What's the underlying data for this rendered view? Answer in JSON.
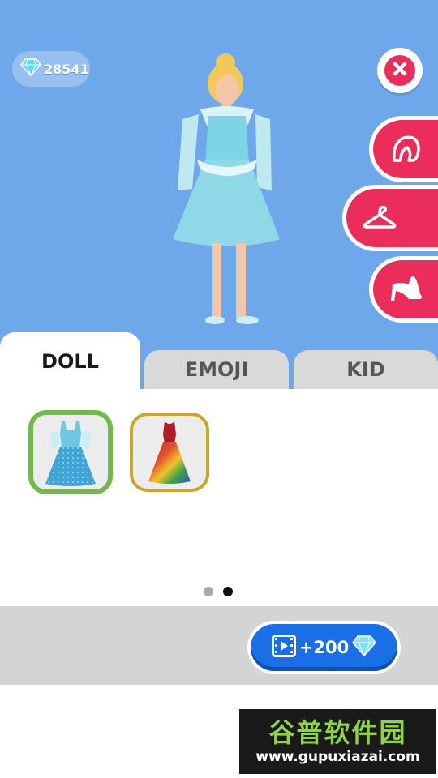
{
  "currency": {
    "gems": "28541",
    "icon": "diamond-icon"
  },
  "close": {
    "icon": "close-icon"
  },
  "categories": [
    {
      "id": "hair",
      "icon": "hair-icon"
    },
    {
      "id": "clothes",
      "icon": "hanger-icon"
    },
    {
      "id": "shoes",
      "icon": "high-heel-icon"
    }
  ],
  "tabs": [
    {
      "label": "DOLL",
      "active": true
    },
    {
      "label": "EMOJI",
      "active": false
    },
    {
      "label": "KID",
      "active": false
    }
  ],
  "items": [
    {
      "name": "blue sparkle gown",
      "selected": true
    },
    {
      "name": "tie-dye dress",
      "selected": false
    }
  ],
  "pagination": {
    "pages": 2,
    "current": 2
  },
  "reward": {
    "label": "+200",
    "icons": [
      "video-ad-icon",
      "diamond-icon"
    ]
  },
  "watermark": {
    "title": "谷普软件园",
    "url": "www.gupuxiazai.com"
  },
  "colors": {
    "accent": "#ea2d5b",
    "sky": "#6fa8ea",
    "button_blue": "#1a6fe6",
    "selected_border": "#72b84b",
    "locked_border": "#c9a52a"
  }
}
